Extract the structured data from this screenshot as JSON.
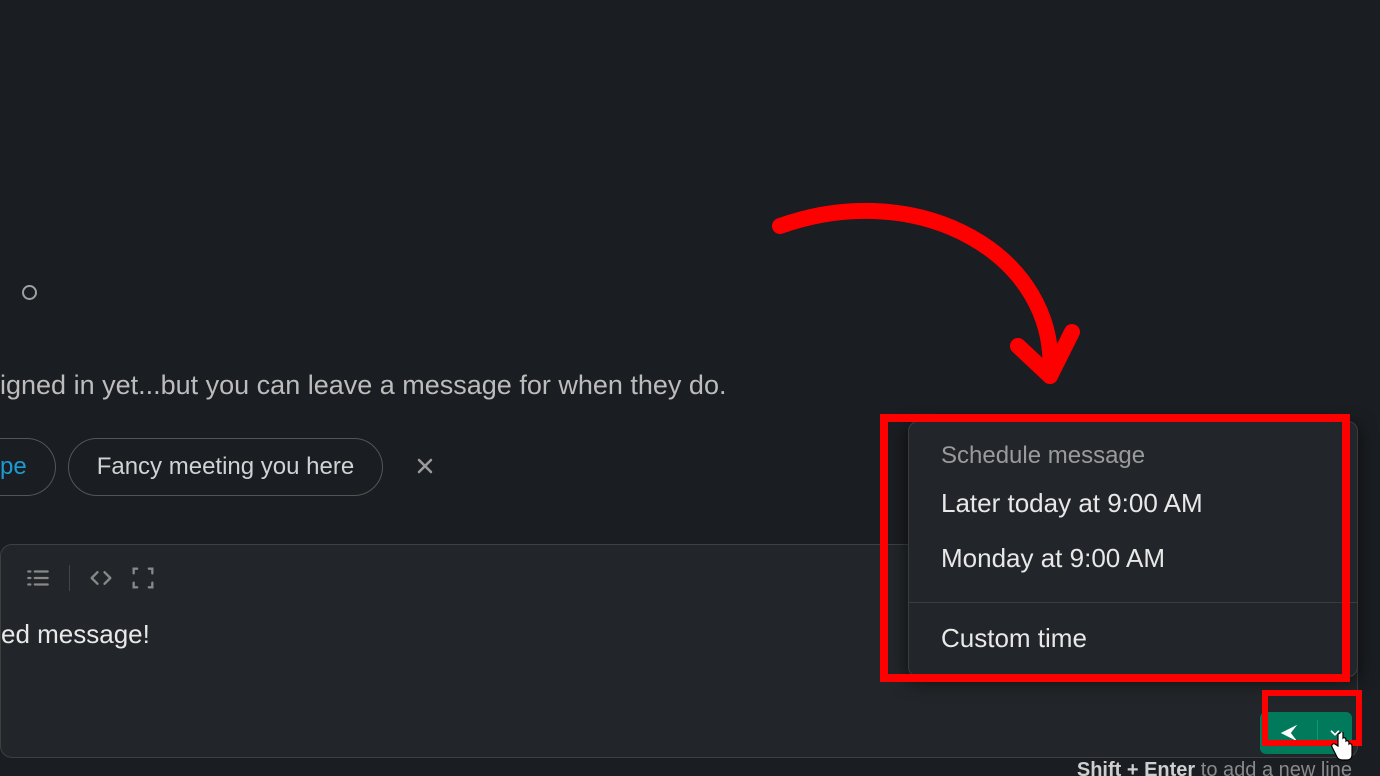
{
  "status_icon": "presence-away-icon",
  "info_text": "igned in yet...but you can leave a message for when they do.",
  "suggestion_pills": {
    "partial": "pe",
    "full": "Fancy meeting you here"
  },
  "toolbar": {
    "list_icon": "indent-list-icon",
    "code_icon": "code-icon",
    "codeblock_icon": "code-block-icon"
  },
  "message_body": "ed message!",
  "schedule_menu": {
    "header": "Schedule message",
    "items": [
      "Later today at 9:00 AM",
      "Monday at 9:00 AM"
    ],
    "custom": "Custom time"
  },
  "send": {
    "icon": "send-icon",
    "dropdown_icon": "chevron-down-icon"
  },
  "hint_prefix": "Shift + Enter",
  "hint_suffix": " to add a new line"
}
